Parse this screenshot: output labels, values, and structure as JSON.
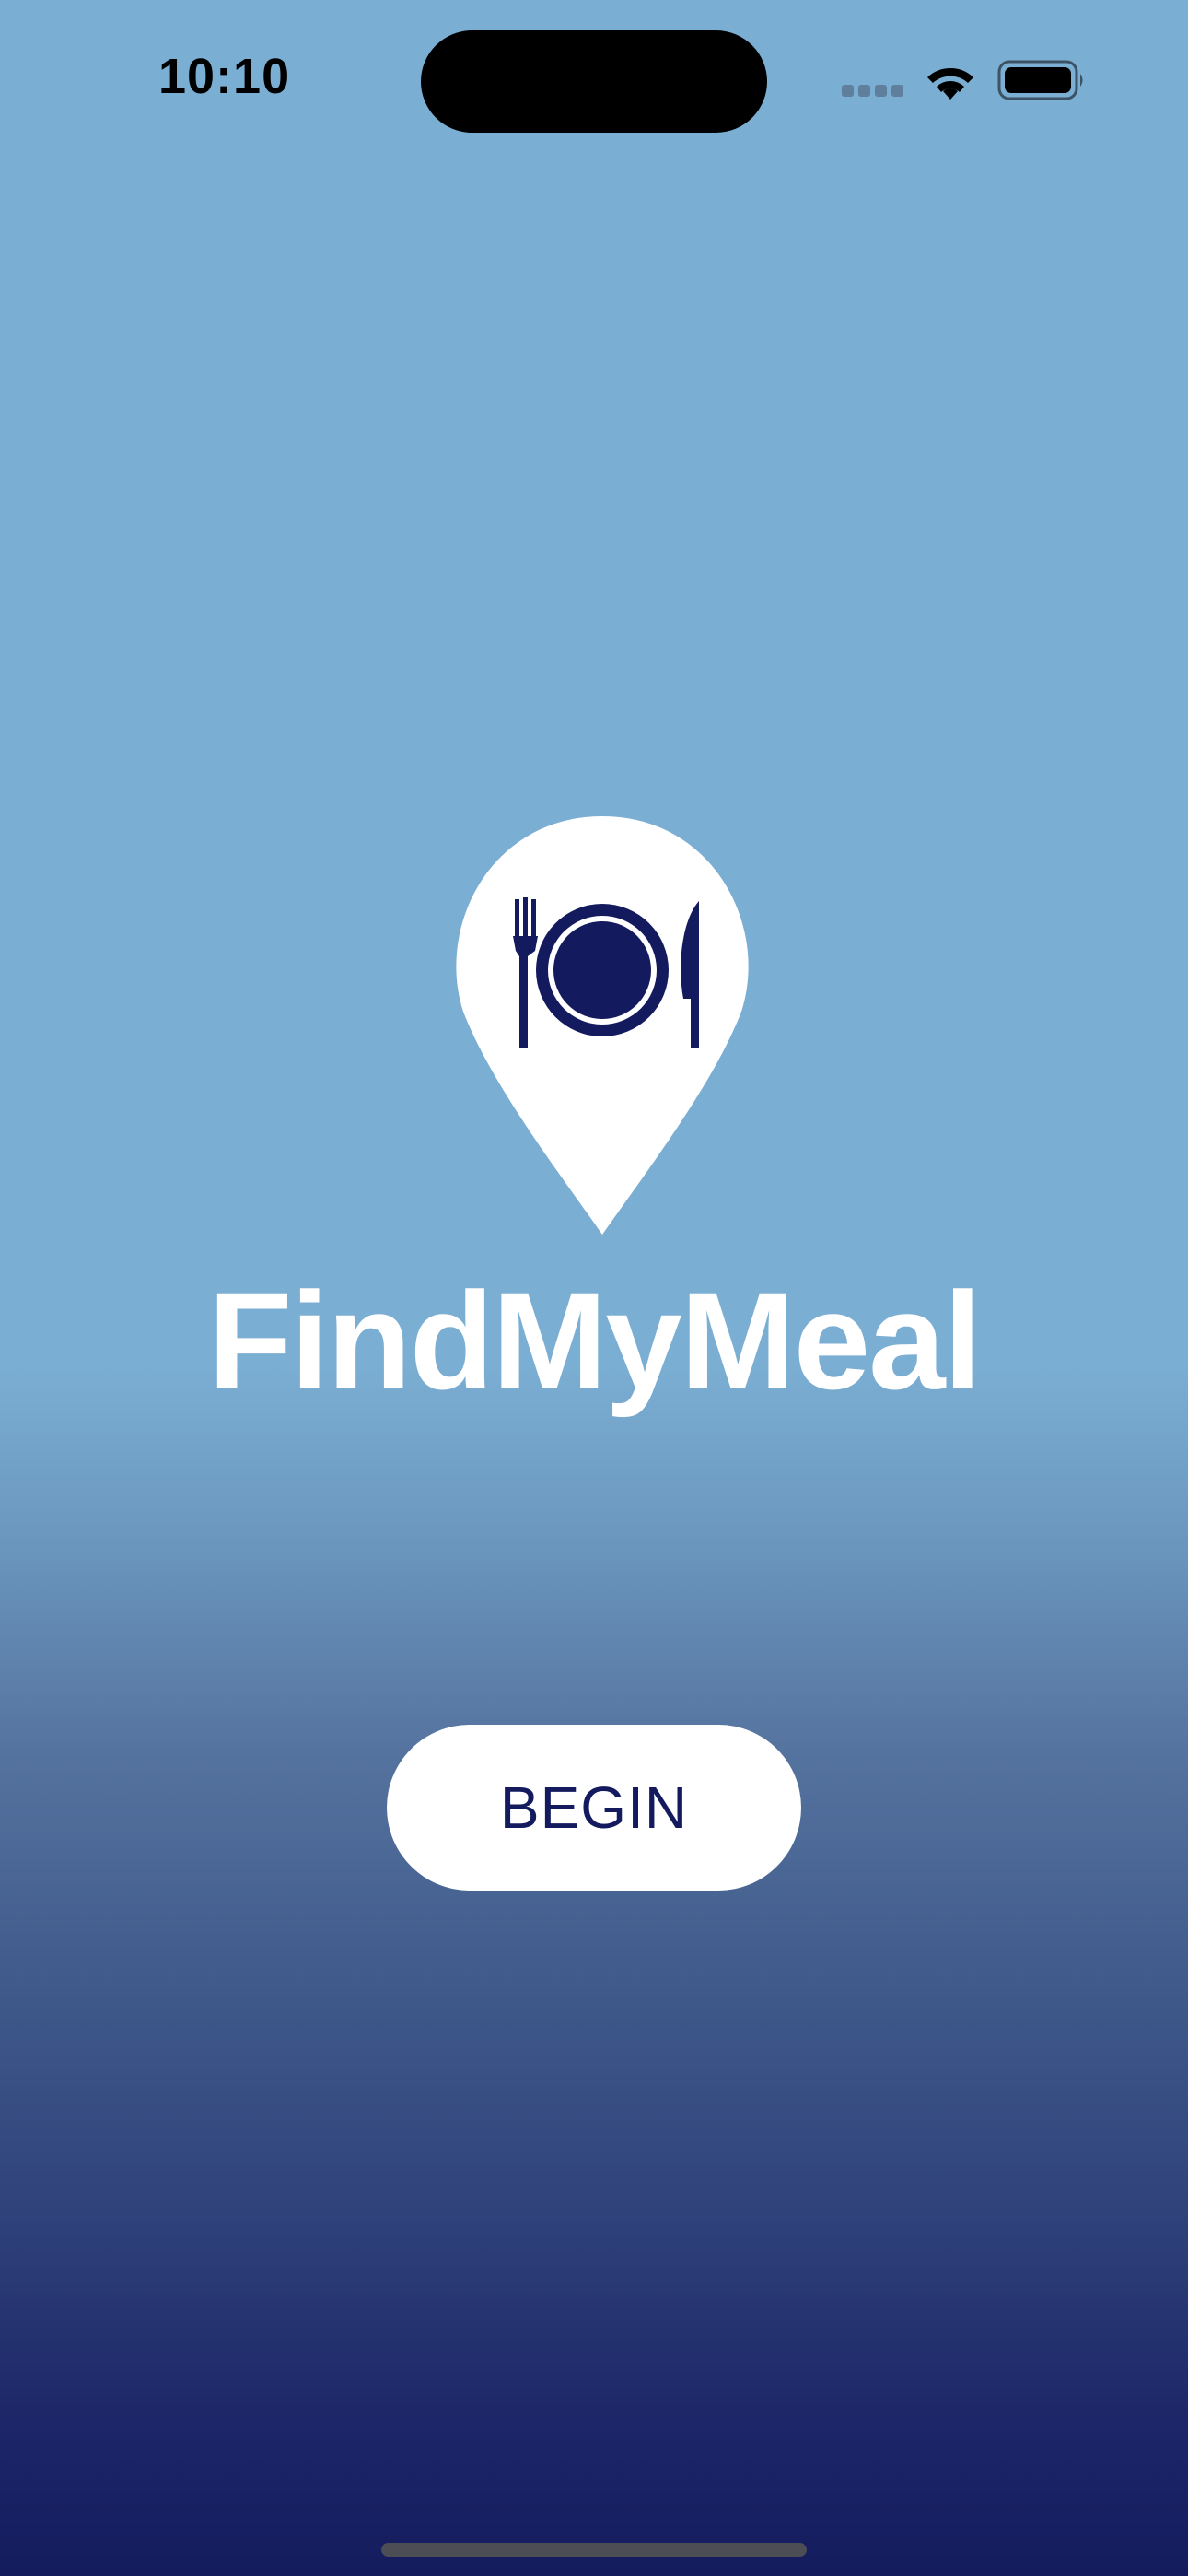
{
  "status_bar": {
    "time": "10:10",
    "icons": [
      "cellular-signal-icon",
      "wifi-icon",
      "battery-icon"
    ]
  },
  "app": {
    "title": "FindMyMeal",
    "logo_icon": "location-pin-plate-cutlery-icon"
  },
  "actions": {
    "begin_label": "BEGIN"
  },
  "colors": {
    "background_top": "#7baed3",
    "background_bottom": "#141c5e",
    "icon_navy": "#141a5e",
    "button_bg": "#ffffff",
    "title_text": "#ffffff"
  }
}
